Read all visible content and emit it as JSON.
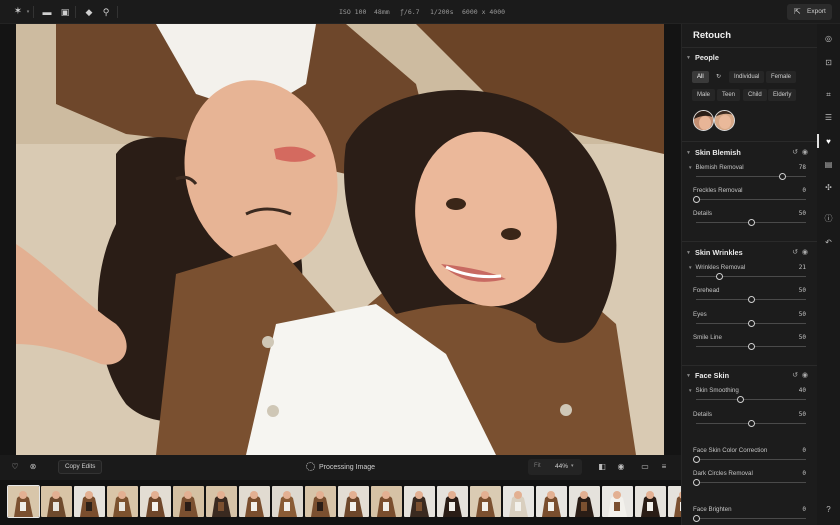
{
  "topbar": {
    "iso": "ISO 100",
    "focal": "48mm",
    "aperture": "ƒ/6.7",
    "shutter": "1/200s",
    "resolution": "6000 x 4000",
    "export_label": "Export"
  },
  "bottombar": {
    "copy_edits_label": "Copy Edits",
    "processing_label": "Processing Image",
    "fit_label": "Fit",
    "zoom_label": "44%"
  },
  "filmstrip": {
    "selected_index": 0,
    "count": 21
  },
  "panel": {
    "title": "Retouch",
    "people": {
      "title": "People",
      "filters": [
        "All",
        "Individual",
        "Female",
        "Male",
        "Teen",
        "Child",
        "Elderly"
      ],
      "selected": "All"
    },
    "skin_blemish": {
      "title": "Skin Blemish",
      "sliders": [
        {
          "label": "Blemish Removal",
          "value": "78",
          "level": 0.78
        },
        {
          "label": "Freckles Removal",
          "value": "0",
          "level": 0
        },
        {
          "label": "Details",
          "value": "50",
          "level": 0.5
        }
      ]
    },
    "skin_wrinkles": {
      "title": "Skin Wrinkles",
      "sliders": [
        {
          "label": "Wrinkles Removal",
          "value": "21",
          "level": 0.21
        },
        {
          "label": "Forehead",
          "value": "50",
          "level": 0.5
        },
        {
          "label": "Eyes",
          "value": "50",
          "level": 0.5
        },
        {
          "label": "Smile Line",
          "value": "50",
          "level": 0.5
        }
      ]
    },
    "face_skin": {
      "title": "Face Skin",
      "sliders": [
        {
          "label": "Skin Smoothing",
          "value": "40",
          "level": 0.4
        },
        {
          "label": "Details",
          "value": "50",
          "level": 0.5
        },
        {
          "label": "Face Skin Color Correction",
          "value": "0",
          "level": 0
        },
        {
          "label": "Dark Circles Removal",
          "value": "0",
          "level": 0
        },
        {
          "label": "Face Brighten",
          "value": "0",
          "level": 0
        }
      ]
    }
  },
  "colors": {
    "background": "#141414",
    "panel": "#1c1c1c",
    "photo_backdrop": "#d8c9b1",
    "jacket": "#7a5030"
  }
}
